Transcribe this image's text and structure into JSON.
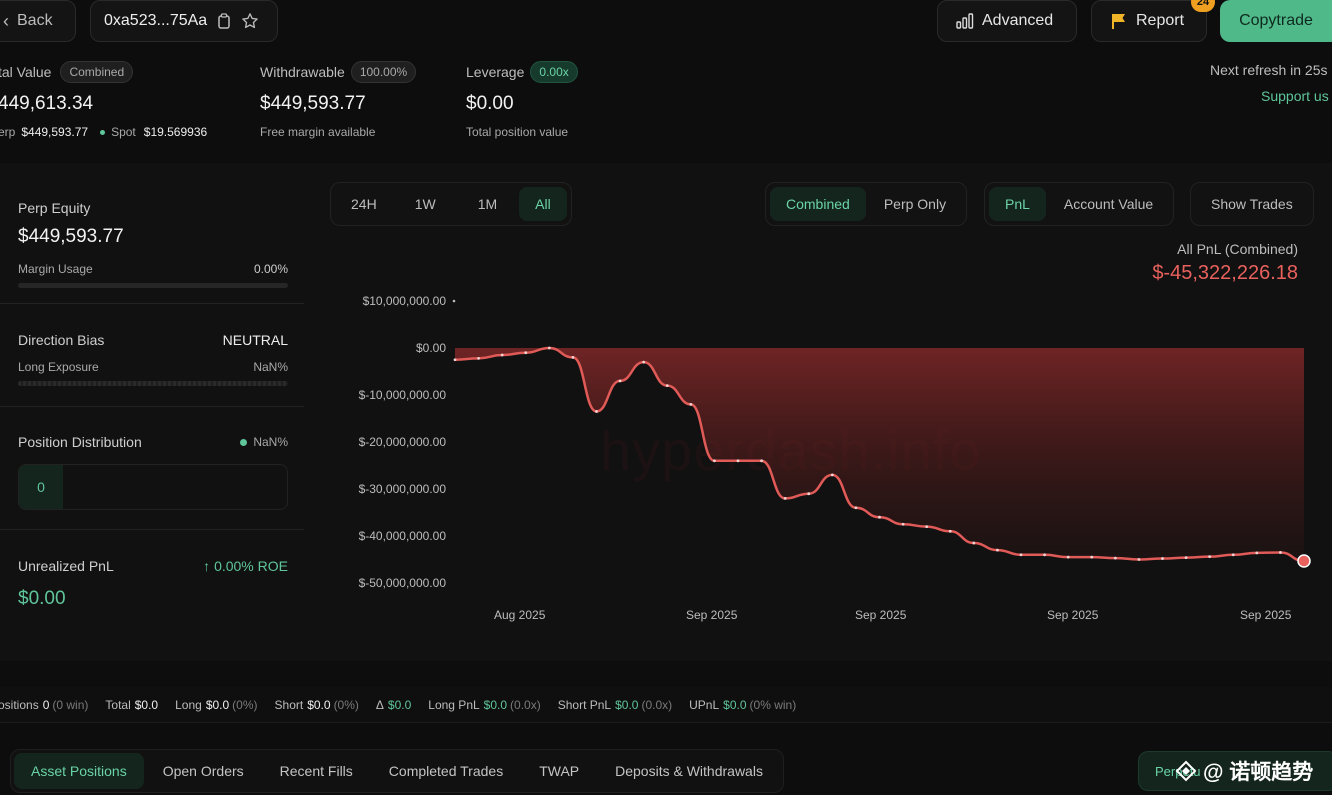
{
  "header": {
    "back_label": "Back",
    "address": "0xa523...75Aa",
    "advanced_label": "Advanced",
    "report_label": "Report",
    "report_count": "24",
    "copytrade_label": "Copytrade",
    "refresh_text": "Next refresh in 25s",
    "support_link": "Support us"
  },
  "stats": {
    "total_value": {
      "label": "tal Value",
      "badge": "Combined",
      "value": "449,613.34",
      "perp_label": "erp",
      "perp_value": "$449,593.77",
      "spot_label": "Spot",
      "spot_value": "$19.569936"
    },
    "withdrawable": {
      "label": "Withdrawable",
      "badge": "100.00%",
      "value": "$449,593.77",
      "sub": "Free margin available"
    },
    "leverage": {
      "label": "Leverage",
      "badge": "0.00x",
      "value": "$0.00",
      "sub": "Total position value"
    }
  },
  "left_panel": {
    "perp_equity_label": "Perp Equity",
    "perp_equity_value": "$449,593.77",
    "margin_usage_label": "Margin Usage",
    "margin_usage_value": "0.00%",
    "direction_bias_label": "Direction Bias",
    "direction_bias_value": "NEUTRAL",
    "long_exposure_label": "Long Exposure",
    "long_exposure_value": "NaN%",
    "position_distribution_label": "Position Distribution",
    "position_distribution_value": "NaN%",
    "position_count": "0",
    "unrealized_pnl_label": "Unrealized PnL",
    "roe_value": "0.00% ROE",
    "unrealized_pnl_value": "$0.00"
  },
  "chart_controls": {
    "ranges": [
      "24H",
      "1W",
      "1M",
      "All"
    ],
    "active_range": "All",
    "modes": [
      "Combined",
      "Perp Only"
    ],
    "metrics": [
      "PnL",
      "Account Value"
    ],
    "show_trades": "Show Trades",
    "summary_label": "All PnL (Combined)",
    "summary_value": "$-45,322,226.18",
    "watermark": "hyperdash.info"
  },
  "chart_data": {
    "type": "area",
    "yticks": [
      "$10,000,000.00",
      "$0.00",
      "$-10,000,000.00",
      "$-20,000,000.00",
      "$-30,000,000.00",
      "$-40,000,000.00",
      "$-50,000,000.00"
    ],
    "ylim": [
      -50000000,
      10000000
    ],
    "xticks": [
      "Aug 2025",
      "Sep 2025",
      "Sep 2025",
      "Sep 2025",
      "Sep 2025"
    ],
    "series": [
      {
        "color": "#e05a57",
        "values": [
          -2500000,
          -2200000,
          -1500000,
          -1000000,
          0,
          -2000000,
          -13500000,
          -7000000,
          -3000000,
          -8000000,
          -12000000,
          -24000000,
          -24000000,
          -24000000,
          -32000000,
          -31000000,
          -27000000,
          -34000000,
          -36000000,
          -37500000,
          -38000000,
          -39000000,
          -41500000,
          -43000000,
          -44000000,
          -44000000,
          -44500000,
          -44500000,
          -44700000,
          -45000000,
          -44800000,
          -44600000,
          -44400000,
          -44000000,
          -43600000,
          -43500000,
          -45322226
        ]
      }
    ]
  },
  "summary_bar": {
    "positions_label": "ositions",
    "positions_value": "0",
    "positions_win": "(0 win)",
    "total_label": "Total",
    "total_value": "$0.0",
    "long_label": "Long",
    "long_value": "$0.0",
    "long_pct": "(0%)",
    "short_label": "Short",
    "short_value": "$0.0",
    "short_pct": "(0%)",
    "delta_label": "Δ",
    "delta_value": "$0.0",
    "long_pnl_label": "Long PnL",
    "long_pnl_value": "$0.0",
    "long_pnl_x": "(0.0x)",
    "short_pnl_label": "Short PnL",
    "short_pnl_value": "$0.0",
    "short_pnl_x": "(0.0x)",
    "upnl_label": "UPnL",
    "upnl_value": "$0.0",
    "upnl_win": "(0% win)"
  },
  "bottom_tabs": [
    "Asset Positions",
    "Open Orders",
    "Recent Fills",
    "Completed Trades",
    "TWAP",
    "Deposits & Withdrawals"
  ],
  "bottom_right_button": "Perpetu",
  "watermark_text": "@ 诺顿趋势",
  "colors": {
    "accent_green": "#5fc59a",
    "loss_red": "#e8615d",
    "copytrade_bg": "#4fb98a"
  }
}
